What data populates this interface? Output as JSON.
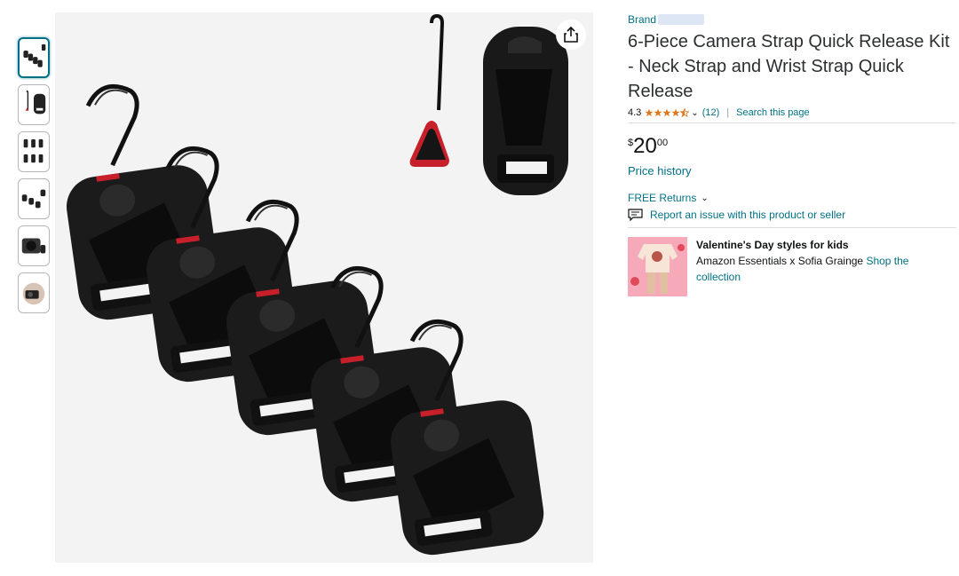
{
  "thumbnails": [
    {
      "name": "thumb-1",
      "selected": true
    },
    {
      "name": "thumb-2",
      "selected": false
    },
    {
      "name": "thumb-3",
      "selected": false
    },
    {
      "name": "thumb-4",
      "selected": false
    },
    {
      "name": "thumb-5",
      "selected": false
    },
    {
      "name": "thumb-6",
      "selected": false
    }
  ],
  "product": {
    "brand_label": "Brand",
    "title": "6-Piece Camera Strap Quick Release Kit - Neck Strap and Wrist Strap Quick Release",
    "rating": "4.3",
    "rating_value": 4.3,
    "review_count": "(12)",
    "separator": "|",
    "search_link": "Search this page",
    "price": {
      "symbol": "$",
      "whole": "20",
      "fraction": "00"
    },
    "price_history": "Price history",
    "returns": "FREE Returns",
    "report": "Report an issue with this product or seller"
  },
  "promo": {
    "title": "Valentine's Day styles for kids",
    "subtitle": "Amazon Essentials x Sofia Grainge",
    "link": "Shop the collection"
  },
  "icons": {
    "share": "share-icon",
    "star": "star-icon",
    "report": "report-icon",
    "chevron": "chevron-down-icon"
  },
  "colors": {
    "link": "#007185",
    "star": "#de7921",
    "selected_thumb_border": "#007185"
  }
}
